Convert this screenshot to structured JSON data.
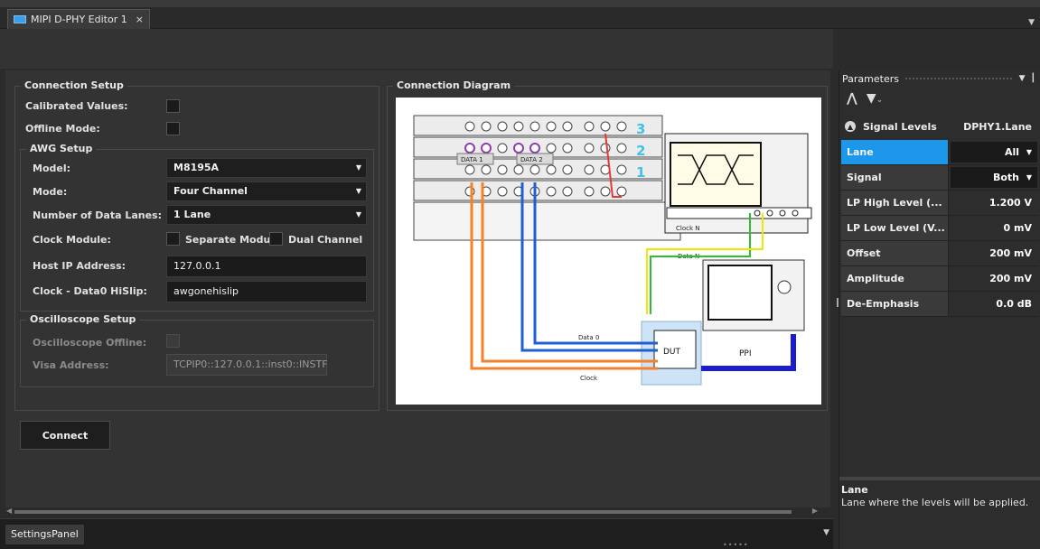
{
  "document_tab": {
    "label": "MIPI D-PHY Editor 1",
    "close": "×"
  },
  "connection_setup": {
    "title": "Connection Setup",
    "calibrated_values": "Calibrated Values:",
    "offline_mode": "Offline Mode:",
    "awg_setup": {
      "title": "AWG Setup",
      "model_label": "Model:",
      "model_value": "M8195A",
      "mode_label": "Mode:",
      "mode_value": "Four Channel",
      "lanes_label": "Number of Data Lanes:",
      "lanes_value": "1 Lane",
      "clock_module_label": "Clock Module:",
      "separate_module": "Separate Module",
      "dual_channel": "Dual Channel",
      "host_ip_label": "Host IP Address:",
      "host_ip_value": "127.0.0.1",
      "hislip_label": "Clock - Data0 HiSlip:",
      "hislip_value": "awgonehislip"
    },
    "scope_setup": {
      "title": "Oscilloscope Setup",
      "offline_label": "Oscilloscope Offline:",
      "visa_label": "Visa Address:",
      "visa_value": "TCPIP0::127.0.0.1::inst0::INSTF"
    }
  },
  "connect_button": "Connect",
  "diagram": {
    "title": "Connection Diagram",
    "labels": {
      "data1": "DATA 1",
      "data2": "DATA 2",
      "clock_n": "Clock N",
      "data_n": "Data N",
      "data0": "Data 0",
      "clock": "Clock",
      "dut": "DUT",
      "ppi": "PPI",
      "n3": "3",
      "n2": "2",
      "n1": "1"
    }
  },
  "bottom_panel": {
    "tab": "SettingsPanel"
  },
  "parameters": {
    "title": "Parameters",
    "section": "Signal Levels",
    "section_key": "DPHY1.Lane",
    "rows": [
      {
        "label": "Lane",
        "value": "All"
      },
      {
        "label": "Signal",
        "value": "Both"
      },
      {
        "label": "LP High Level (...",
        "value": "1.200 V"
      },
      {
        "label": "LP Low Level (V...",
        "value": "0 mV"
      },
      {
        "label": "Offset",
        "value": "200 mV"
      },
      {
        "label": "Amplitude",
        "value": "200 mV"
      },
      {
        "label": "De-Emphasis",
        "value": "0.0 dB"
      }
    ],
    "description_title": "Lane",
    "description_text": "Lane where the levels will be applied."
  },
  "colors": {
    "accent": "#1c97ea",
    "orange": "#f5822a",
    "blue": "#1f5fd1",
    "purple": "#8b3fa8",
    "green": "#2cc12c",
    "yellow": "#f0e800",
    "red": "#e23a3a"
  }
}
